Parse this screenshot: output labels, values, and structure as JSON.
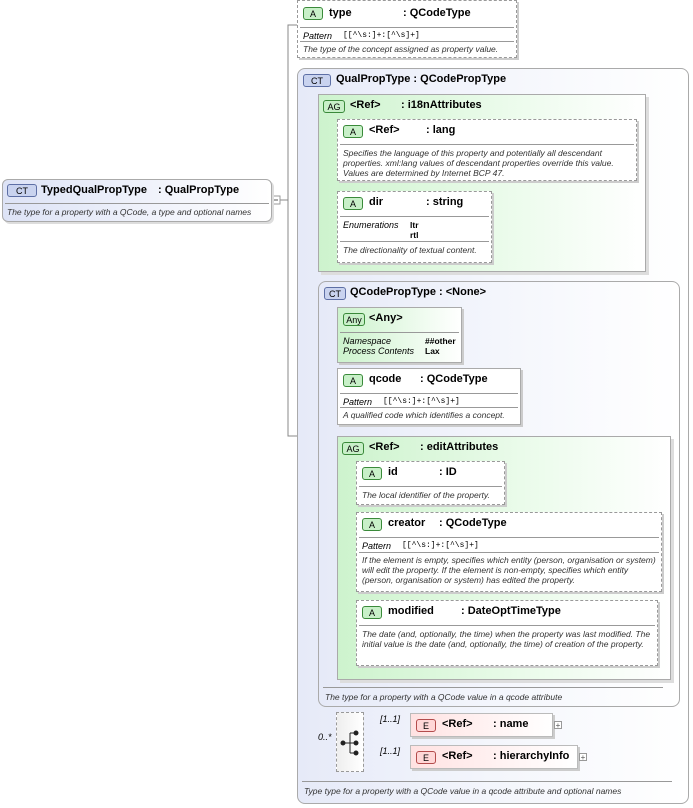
{
  "root": {
    "badge": "CT",
    "title": "TypedQualPropType",
    "base": ": QualPropType",
    "desc": "The type for a property with a QCode, a type and optional names"
  },
  "type_attr": {
    "badge": "A",
    "name": "type",
    "type": ": QCodeType",
    "pattern_label": "Pattern",
    "pattern_value": "[[^\\s:]+:[^\\s]+]",
    "desc": "The type of the concept assigned as property value."
  },
  "qualprop": {
    "badge": "CT",
    "title": "QualPropType : QCodePropType",
    "i18n": {
      "badge": "AG",
      "ref": "<Ref>",
      "name": ": i18nAttributes",
      "lang": {
        "badge": "A",
        "ref": "<Ref>",
        "name": ": lang",
        "desc": "Specifies the language of this property and potentially all descendant properties. xml:lang values of descendant properties override this value. Values are determined by Internet BCP 47."
      },
      "dir": {
        "badge": "A",
        "name": "dir",
        "type": ": string",
        "enum_label": "Enumerations",
        "enum_values": [
          "ltr",
          "rtl"
        ],
        "desc": "The directionality of textual content."
      }
    }
  },
  "qcodeprop": {
    "badge": "CT",
    "title": "QCodePropType : <None>",
    "any": {
      "badge": "Any",
      "name": "<Any>",
      "ns_label": "Namespace",
      "ns_value": "##other",
      "pc_label": "Process Contents",
      "pc_value": "Lax"
    },
    "qcode": {
      "badge": "A",
      "name": "qcode",
      "type": ": QCodeType",
      "pattern_label": "Pattern",
      "pattern_value": "[[^\\s:]+:[^\\s]+]",
      "desc": "A qualified code which identifies a concept."
    },
    "edit": {
      "badge": "AG",
      "ref": "<Ref>",
      "name": ": editAttributes",
      "id": {
        "badge": "A",
        "name": "id",
        "type": ": ID",
        "desc": "The local identifier of the property."
      },
      "creator": {
        "badge": "A",
        "name": "creator",
        "type": ": QCodeType",
        "pattern_label": "Pattern",
        "pattern_value": "[[^\\s:]+:[^\\s]+]",
        "desc": "If the element is empty, specifies which entity (person, organisation or system) will edit the property. If the element is non-empty, specifies which entity (person, organisation or system) has edited the property."
      },
      "modified": {
        "badge": "A",
        "name": "modified",
        "type": ": DateOptTimeType",
        "desc": "The date (and, optionally, the time) when the property was last modified. The initial value is the date (and, optionally, the time) of creation of the property."
      }
    },
    "footer": "The type for a property with a QCode value in a qcode attribute"
  },
  "sequence": {
    "occurs": "0..*",
    "children": [
      {
        "occurs": "[1..1]",
        "badge": "E",
        "ref": "<Ref>",
        "name": ": name",
        "expand": "+"
      },
      {
        "occurs": "[1..1]",
        "badge": "E",
        "ref": "<Ref>",
        "name": ": hierarchyInfo",
        "expand": "+"
      }
    ]
  },
  "footer": "Type type for a property with a  QCode value in a qcode attribute and optional names",
  "colors": {
    "attr_badge": "#c8f0c8",
    "ct_badge": "#c9d3ef",
    "element_badge": "#ffd7d7",
    "group_fill": "#cdf3cd"
  }
}
